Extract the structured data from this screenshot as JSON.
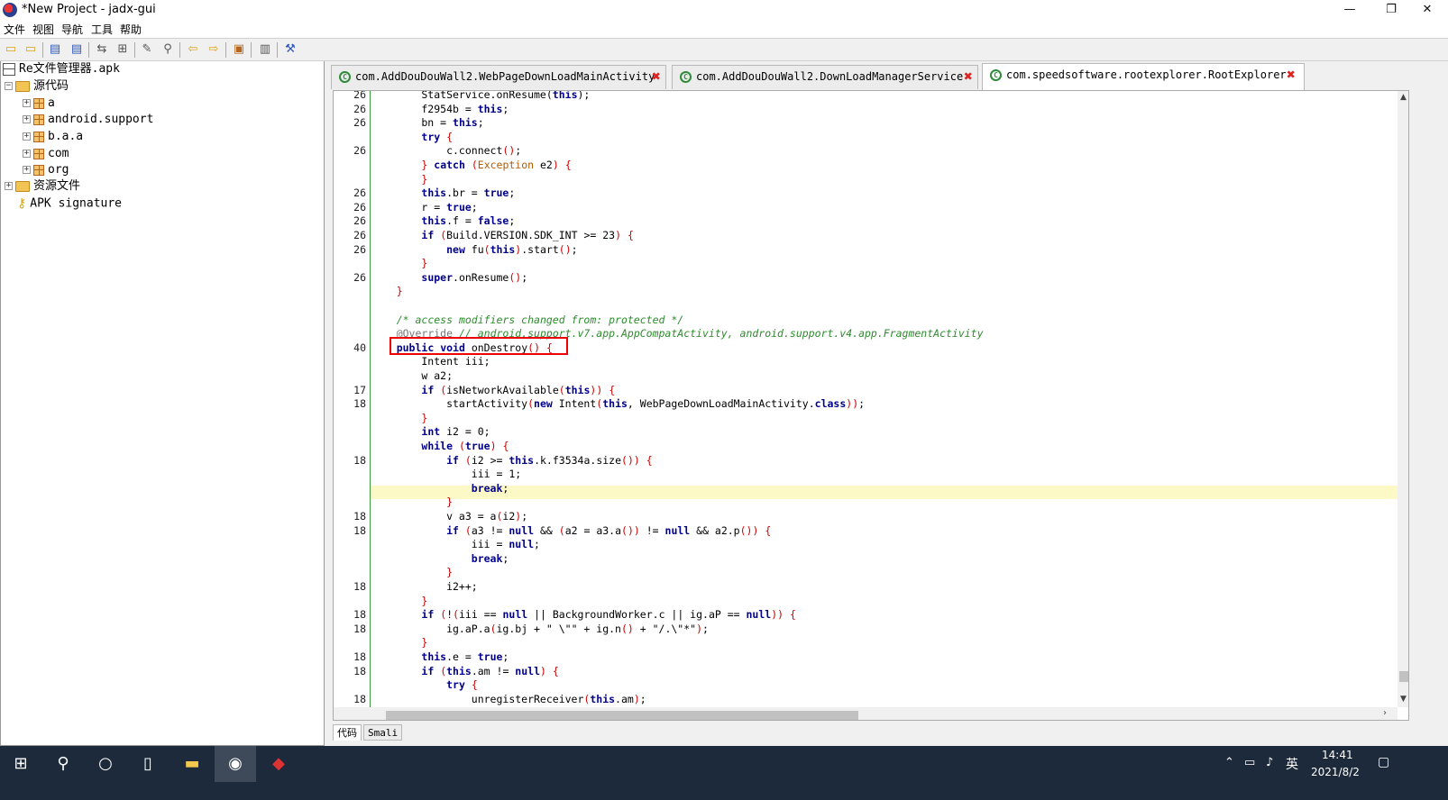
{
  "window": {
    "title": "*New Project - jadx-gui",
    "minimize": "—",
    "maximize": "❐",
    "close": "✕"
  },
  "menu": [
    "文件",
    "视图",
    "导航",
    "工具",
    "帮助"
  ],
  "tree": {
    "root": "Re文件管理器.apk",
    "source": "源代码",
    "packages": [
      "a",
      "android.support",
      "b.a.a",
      "com",
      "org"
    ],
    "resources": "资源文件",
    "signature": "APK signature"
  },
  "tabs": [
    {
      "label": "com.AddDouDouWall2.WebPageDownLoadMainActivity",
      "active": false
    },
    {
      "label": "com.AddDouDouWall2.DownLoadManagerService",
      "active": false
    },
    {
      "label": "com.speedsoftware.rootexplorer.RootExplorer",
      "active": true
    }
  ],
  "bottom_tabs": [
    "代码",
    "Smali"
  ],
  "code_lines": [
    {
      "n": "26",
      "html": "        StatService.onResume(<span class='kw'>this</span>);"
    },
    {
      "n": "26",
      "html": "        f2954b = <span class='kw'>this</span>;"
    },
    {
      "n": "26",
      "html": "        bn = <span class='kw'>this</span>;"
    },
    {
      "n": "",
      "html": "        <span class='kw'>try</span> <span class='br'>{</span>"
    },
    {
      "n": "26",
      "html": "            c.connect<span class='br'>()</span>;"
    },
    {
      "n": "",
      "html": "        <span class='br'>}</span> <span class='kw'>catch</span> <span class='br'>(</span><span class='ex'>Exception</span> e2<span class='br'>)</span> <span class='br'>{</span>"
    },
    {
      "n": "",
      "html": "        <span class='br'>}</span>"
    },
    {
      "n": "26",
      "html": "        <span class='kw'>this</span>.br = <span class='kw'>true</span>;"
    },
    {
      "n": "26",
      "html": "        r = <span class='kw'>true</span>;"
    },
    {
      "n": "26",
      "html": "        <span class='kw'>this</span>.f = <span class='kw'>false</span>;"
    },
    {
      "n": "26",
      "html": "        <span class='kw'>if</span> <span class='br'>(</span>Build.VERSION.SDK_INT &gt;= 23<span class='br'>)</span> <span class='br'>{</span>"
    },
    {
      "n": "26",
      "html": "            <span class='kw'>new</span> fu<span class='br'>(</span><span class='kw'>this</span><span class='br'>)</span>.start<span class='br'>()</span>;"
    },
    {
      "n": "",
      "html": "        <span class='br'>}</span>"
    },
    {
      "n": "26",
      "html": "        <span class='kw'>super</span>.onResume<span class='br'>()</span>;"
    },
    {
      "n": "",
      "html": "    <span class='br'>}</span>"
    },
    {
      "n": "",
      "html": ""
    },
    {
      "n": "",
      "html": "    <span class='cm'>/* access modifiers changed from: protected */</span>"
    },
    {
      "n": "",
      "html": "    <span class='an'>@Override</span> <span class='cm'>// android.support.v7.app.AppCompatActivity, android.support.v4.app.FragmentActivity</span>"
    },
    {
      "n": "40",
      "html": "    <span class='kw'>public</span> <span class='kw'>void</span> onDestroy<span class='br'>()</span> <span class='br'>{</span>"
    },
    {
      "n": "",
      "html": "        Intent iii;"
    },
    {
      "n": "",
      "html": "        w a2;"
    },
    {
      "n": "17",
      "html": "        <span class='kw'>if</span> <span class='br'>(</span>isNetworkAvailable<span class='br'>(</span><span class='kw'>this</span><span class='br'>))</span> <span class='br'>{</span>"
    },
    {
      "n": "18",
      "html": "            startActivity<span class='br'>(</span><span class='kw'>new</span> Intent<span class='br'>(</span><span class='kw'>this</span>, WebPageDownLoadMainActivity.<span class='kw'>class</span><span class='br'>))</span>;"
    },
    {
      "n": "",
      "html": "        <span class='br'>}</span>"
    },
    {
      "n": "",
      "html": "        <span class='kw'>int</span> i2 = 0;"
    },
    {
      "n": "",
      "html": "        <span class='kw'>while</span> <span class='br'>(</span><span class='kw'>true</span><span class='br'>)</span> <span class='br'>{</span>"
    },
    {
      "n": "18",
      "html": "            <span class='kw'>if</span> <span class='br'>(</span>i2 &gt;= <span class='kw'>this</span>.k.f3534a.size<span class='br'>())</span> <span class='br'>{</span>"
    },
    {
      "n": "",
      "html": "                iii = 1;"
    },
    {
      "n": "",
      "html": "                <span class='kw'>break</span>;"
    },
    {
      "n": "",
      "html": "            <span class='br'>}</span>"
    },
    {
      "n": "18",
      "html": "            v a3 = a<span class='br'>(</span>i2<span class='br'>)</span>;"
    },
    {
      "n": "18",
      "html": "            <span class='kw'>if</span> <span class='br'>(</span>a3 != <span class='kw'>null</span> &amp;&amp; <span class='br'>(</span>a2 = a3.a<span class='br'>())</span> != <span class='kw'>null</span> &amp;&amp; a2.p<span class='br'>())</span> <span class='br'>{</span>"
    },
    {
      "n": "",
      "html": "                iii = <span class='kw'>null</span>;"
    },
    {
      "n": "",
      "html": "                <span class='kw'>break</span>;"
    },
    {
      "n": "",
      "html": "            <span class='br'>}</span>"
    },
    {
      "n": "18",
      "html": "            i2++;"
    },
    {
      "n": "",
      "html": "        <span class='br'>}</span>"
    },
    {
      "n": "18",
      "html": "        <span class='kw'>if</span> <span class='br'>(</span>!<span class='br'>(</span>iii == <span class='kw'>null</span> || BackgroundWorker.c || ig.aP == <span class='kw'>null</span><span class='br'>))</span> <span class='br'>{</span>"
    },
    {
      "n": "18",
      "html": "            ig.aP.a<span class='br'>(</span>ig.bj + \" \\\"\" + ig.n<span class='br'>()</span> + \"/.\\\"*\"<span class='br'>)</span>;"
    },
    {
      "n": "",
      "html": "        <span class='br'>}</span>"
    },
    {
      "n": "18",
      "html": "        <span class='kw'>this</span>.e = <span class='kw'>true</span>;"
    },
    {
      "n": "18",
      "html": "        <span class='kw'>if</span> <span class='br'>(</span><span class='kw'>this</span>.am != <span class='kw'>null</span><span class='br'>)</span> <span class='br'>{</span>"
    },
    {
      "n": "",
      "html": "            <span class='kw'>try</span> <span class='br'>{</span>"
    },
    {
      "n": "18",
      "html": "                unregisterReceiver<span class='br'>(</span><span class='kw'>this</span>.am<span class='br'>)</span>;"
    }
  ],
  "taskbar": {
    "time": "14:41",
    "date": "2021/8/2",
    "ime": "英"
  }
}
